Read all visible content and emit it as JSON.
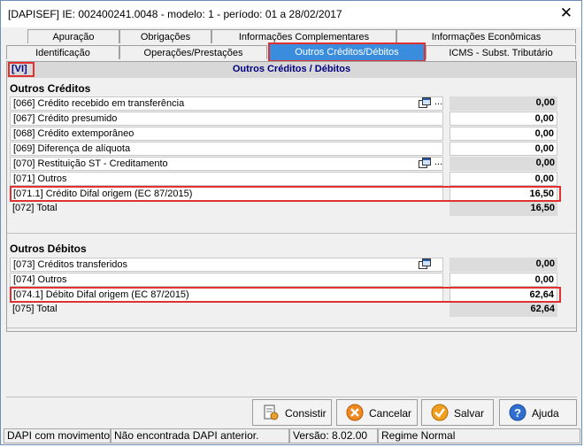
{
  "window": {
    "title": "[DAPISEF] IE: 002400241.0048 -  modelo: 1 -  período: 01 a 28/02/2017",
    "close_glyph": "✕"
  },
  "tabs_top": [
    "Apuração",
    "Obrigações",
    "Informações Complementares",
    "Informações Econômicas"
  ],
  "tabs_bottom": [
    "Identificação",
    "Operações/Prestações",
    "Outros Créditos/Débitos",
    "ICMS - Subst. Tributário"
  ],
  "active_tab": "Outros Créditos/Débitos",
  "section": {
    "number": "[VI]",
    "title": "Outros Créditos / Débitos"
  },
  "creditos": {
    "title": "Outros Créditos",
    "rows": [
      {
        "label": "[066] Crédito recebido em transferência",
        "value": "0,00"
      },
      {
        "label": "[067] Crédito presumido",
        "value": "0,00"
      },
      {
        "label": "[068] Crédito extemporâneo",
        "value": "0,00"
      },
      {
        "label": "[069] Diferença de alíquota",
        "value": "0,00"
      },
      {
        "label": "[070] Restituição ST - Creditamento",
        "value": "0,00"
      },
      {
        "label": "[071] Outros",
        "value": "0,00"
      },
      {
        "label": "[071.1] Crédito Difal origem (EC 87/2015)",
        "value": "16,50"
      },
      {
        "label": "[072] Total",
        "value": "16,50"
      }
    ]
  },
  "debitos": {
    "title": "Outros Débitos",
    "rows": [
      {
        "label": "[073] Créditos transferidos",
        "value": "0,00"
      },
      {
        "label": "[074] Outros",
        "value": "0,00"
      },
      {
        "label": "[074.1] Débito Difal origem (EC 87/2015)",
        "value": "62,64"
      },
      {
        "label": "[075] Total",
        "value": "62,64"
      }
    ]
  },
  "lookup_dots": "...",
  "buttons": {
    "consultar": "Consistir",
    "cancelar": "Cancelar",
    "salvar": "Salvar",
    "ajuda": "Ajuda"
  },
  "status_bar": [
    "DAPI com movimento",
    "Não encontrada DAPI anterior.",
    "Versão: 8.02.00",
    "Regime Normal"
  ],
  "colors": {
    "active_tab": "#3a8ddd",
    "highlight": "#e03030",
    "section_title": "#000080"
  }
}
